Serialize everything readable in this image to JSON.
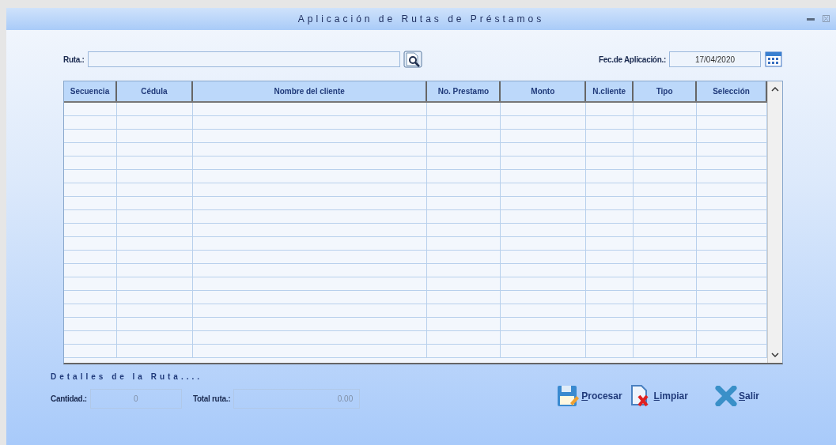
{
  "window": {
    "title": "Aplicación de Rutas de Préstamos"
  },
  "route": {
    "label": "Ruta.:"
  },
  "date": {
    "label": "Fec.de Aplicación.:",
    "value": "17/04/2020"
  },
  "table": {
    "columns": [
      "Secuencia",
      "Cédula",
      "Nombre del cliente",
      "No. Prestamo",
      "Monto",
      "N.cliente",
      "Tipo",
      "Selección"
    ]
  },
  "details": {
    "title": "Detalles de la Ruta....",
    "quantity": {
      "label": "Cantidad.:",
      "value": "0"
    },
    "total": {
      "label": "Total ruta.:",
      "value": "0.00"
    }
  },
  "buttons": [
    {
      "kind": "process",
      "label": "Procesar",
      "mnemonic_underlined": true
    },
    {
      "kind": "clear",
      "label": "Limpiar",
      "mnemonic_underlined": true
    },
    {
      "kind": "exit",
      "label": "Salir",
      "mnemonic_underlined": true
    }
  ]
}
